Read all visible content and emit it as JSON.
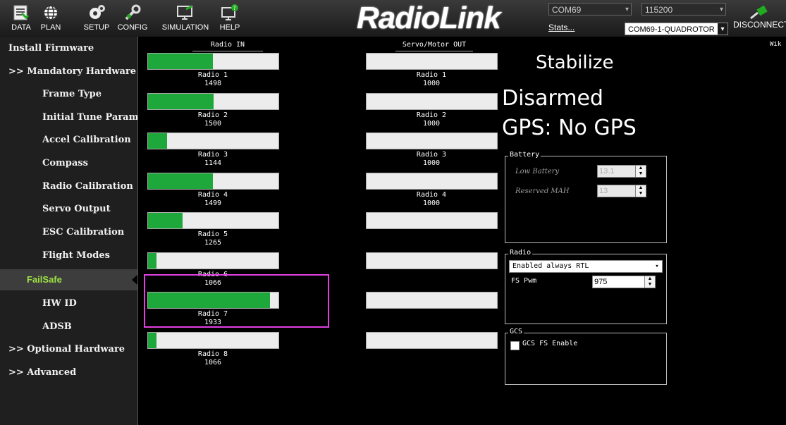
{
  "nav": {
    "items": [
      {
        "label": "DATA"
      },
      {
        "label": "PLAN"
      },
      {
        "label": "SETUP"
      },
      {
        "label": "CONFIG"
      },
      {
        "label": "SIMULATION"
      },
      {
        "label": "HELP"
      }
    ],
    "logo_text": "RadioLink",
    "port": "COM69",
    "baud": "115200",
    "stats_label": "Stats...",
    "vehicle": "COM69-1-QUADROTOR",
    "disconnect_label": "DISCONNECT",
    "wiki_label": "Wik"
  },
  "sidebar": {
    "items": [
      {
        "label": "Install Firmware"
      },
      {
        "label": ">> Mandatory Hardware"
      },
      {
        "label": "Frame Type"
      },
      {
        "label": "Initial Tune Parameters"
      },
      {
        "label": "Accel Calibration"
      },
      {
        "label": "Compass"
      },
      {
        "label": "Radio Calibration"
      },
      {
        "label": "Servo Output"
      },
      {
        "label": "ESC Calibration"
      },
      {
        "label": "Flight Modes"
      },
      {
        "label": "FailSafe"
      },
      {
        "label": "HW ID"
      },
      {
        "label": "ADSB"
      },
      {
        "label": ">> Optional Hardware"
      },
      {
        "label": ">> Advanced"
      }
    ],
    "selected": "FailSafe"
  },
  "radio_in": {
    "header": "Radio IN",
    "channels": [
      {
        "name": "Radio 1",
        "value": "1498",
        "level": 0.498
      },
      {
        "name": "Radio 2",
        "value": "1500",
        "level": 0.5
      },
      {
        "name": "Radio 3",
        "value": "1144",
        "level": 0.144
      },
      {
        "name": "Radio 4",
        "value": "1499",
        "level": 0.499
      },
      {
        "name": "Radio 5",
        "value": "1265",
        "level": 0.265
      },
      {
        "name": "Radio 6",
        "value": "1066",
        "level": 0.066
      },
      {
        "name": "Radio 7",
        "value": "1933",
        "level": 0.933
      },
      {
        "name": "Radio 8",
        "value": "1066",
        "level": 0.066
      }
    ]
  },
  "servo_out": {
    "header": "Servo/Motor OUT",
    "channels": [
      {
        "name": "Radio 1",
        "value": "1000",
        "level": 0
      },
      {
        "name": "Radio 2",
        "value": "1000",
        "level": 0
      },
      {
        "name": "Radio 3",
        "value": "1000",
        "level": 0
      },
      {
        "name": "Radio 4",
        "value": "1000",
        "level": 0
      },
      {
        "name": "",
        "value": "",
        "level": 0
      },
      {
        "name": "",
        "value": "",
        "level": 0
      },
      {
        "name": "",
        "value": "",
        "level": 0
      },
      {
        "name": "",
        "value": "",
        "level": 0
      }
    ]
  },
  "status": {
    "mode": "Stabilize",
    "armed": "Disarmed",
    "gps": "GPS: No GPS"
  },
  "battery": {
    "title": "Battery",
    "low_label": "Low Battery",
    "low_value": "13.1",
    "reserved_label": "Reserved MAH",
    "reserved_value": "13"
  },
  "radio": {
    "title": "Radio",
    "action": "Enabled always RTL",
    "pwm_label": "FS Pwm",
    "pwm_value": "975"
  },
  "gcs": {
    "title": "GCS",
    "enable_label": "GCS FS Enable"
  },
  "colors": {
    "bar_fill": "#1ea83b",
    "selected_text": "#9ce243",
    "highlight": "#e040e0"
  }
}
